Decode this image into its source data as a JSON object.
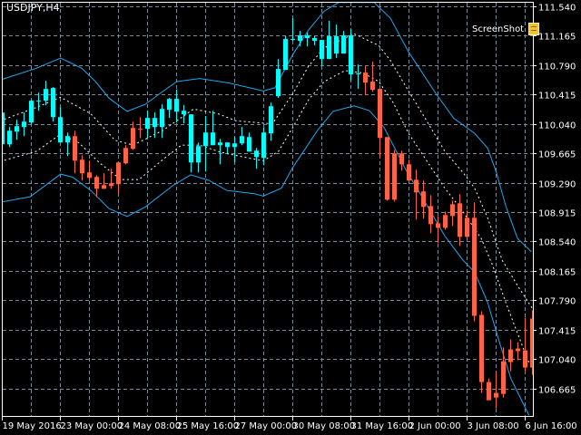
{
  "symbol_label": "USDJPY,H4",
  "screenshot_label": "ScreenShot",
  "colors": {
    "bull": "#00FFFF",
    "bear": "#FF6347",
    "band_outer": "#1EA8F0",
    "band_inner": "#FFFFFF",
    "grid": "#7A8A9A",
    "frame": "#FFFFFF"
  },
  "chart_data": {
    "type": "candlestick",
    "symbol": "USDJPY",
    "timeframe": "H4",
    "ylim": [
      106.32,
      111.59
    ],
    "price_ticks": [
      "111.540",
      "111.165",
      "110.790",
      "110.415",
      "110.040",
      "109.665",
      "109.290",
      "108.915",
      "108.540",
      "108.165",
      "107.790",
      "107.415",
      "107.040",
      "106.665"
    ],
    "time_ticks": [
      "19 May 2016",
      "23 May 00:00",
      "24 May 08:00",
      "25 May 16:00",
      "27 May 00:00",
      "30 May 08:00",
      "31 May 16:00",
      "2 Jun 00:00",
      "3 Jun 08:00",
      "6 Jun 16:00"
    ],
    "candles_ohlc_color": [
      [
        109.78,
        110.231,
        109.745,
        110.185,
        "u"
      ],
      [
        109.953,
        110.0,
        109.745,
        109.78,
        "u"
      ],
      [
        109.942,
        110.092,
        109.838,
        110.011,
        "u"
      ],
      [
        110.0,
        110.185,
        109.884,
        110.069,
        "u"
      ],
      [
        110.058,
        110.347,
        110.035,
        110.336,
        "u"
      ],
      [
        110.336,
        110.44,
        110.208,
        110.33,
        "u"
      ],
      [
        110.336,
        110.59,
        110.278,
        110.486,
        "u"
      ],
      [
        110.498,
        110.509,
        110.069,
        110.127,
        "u"
      ],
      [
        110.127,
        110.255,
        109.803,
        109.803,
        "u"
      ],
      [
        109.803,
        109.93,
        109.629,
        109.884,
        "u"
      ],
      [
        109.884,
        109.953,
        109.409,
        109.571,
        "d"
      ],
      [
        109.583,
        109.64,
        109.317,
        109.409,
        "d"
      ],
      [
        109.421,
        109.571,
        109.317,
        109.351,
        "d"
      ],
      [
        109.363,
        109.386,
        109.108,
        109.212,
        "d"
      ],
      [
        109.212,
        109.409,
        109.212,
        109.259,
        "d"
      ],
      [
        109.247,
        109.467,
        109.212,
        109.282,
        "d"
      ],
      [
        109.27,
        109.548,
        109.143,
        109.548,
        "d"
      ],
      [
        109.537,
        109.768,
        109.525,
        109.733,
        "d"
      ],
      [
        109.722,
        110.069,
        109.71,
        109.988,
        "d"
      ],
      [
        109.977,
        110.127,
        109.861,
        109.97,
        "d"
      ],
      [
        109.977,
        110.208,
        109.861,
        110.116,
        "u"
      ],
      [
        110.116,
        110.185,
        109.861,
        110.0,
        "u"
      ],
      [
        110.0,
        110.289,
        109.861,
        110.231,
        "u"
      ],
      [
        110.22,
        110.37,
        110.116,
        110.359,
        "u"
      ],
      [
        110.359,
        110.475,
        110.058,
        110.197,
        "u"
      ],
      [
        110.208,
        110.278,
        110.046,
        110.162,
        "u"
      ],
      [
        110.162,
        110.162,
        109.421,
        109.548,
        "u"
      ],
      [
        109.548,
        109.803,
        109.421,
        109.757,
        "u"
      ],
      [
        109.757,
        110.139,
        109.432,
        109.93,
        "u"
      ],
      [
        109.93,
        110.208,
        109.768,
        109.768,
        "u"
      ],
      [
        109.768,
        109.849,
        109.525,
        109.803,
        "u"
      ],
      [
        109.803,
        109.803,
        109.652,
        109.745,
        "u"
      ],
      [
        109.745,
        109.872,
        109.548,
        109.791,
        "u"
      ],
      [
        109.791,
        110.0,
        109.768,
        109.884,
        "u"
      ],
      [
        109.872,
        109.93,
        109.687,
        109.687,
        "u"
      ],
      [
        109.699,
        109.733,
        109.467,
        109.618,
        "u"
      ],
      [
        109.606,
        110.0,
        109.513,
        109.93,
        "u"
      ],
      [
        109.919,
        110.312,
        109.826,
        110.266,
        "u"
      ],
      [
        110.394,
        110.868,
        110.37,
        110.741,
        "u"
      ],
      [
        110.729,
        111.158,
        110.729,
        111.123,
        "u"
      ],
      [
        111.123,
        111.389,
        111.1,
        111.12,
        "u"
      ],
      [
        111.1,
        111.227,
        111.03,
        111.169,
        "u"
      ],
      [
        111.169,
        111.204,
        111.03,
        111.135,
        "u"
      ],
      [
        111.135,
        111.158,
        111.042,
        111.1,
        "u"
      ],
      [
        111.111,
        111.111,
        110.787,
        110.868,
        "u"
      ],
      [
        110.868,
        111.355,
        110.868,
        111.158,
        "u"
      ],
      [
        111.158,
        111.308,
        110.88,
        110.938,
        "u"
      ],
      [
        110.938,
        111.227,
        110.938,
        111.169,
        "u"
      ],
      [
        111.169,
        111.25,
        110.59,
        110.671,
        "u"
      ],
      [
        110.683,
        110.799,
        110.486,
        110.68,
        "u"
      ],
      [
        110.695,
        110.776,
        110.405,
        110.567,
        "d"
      ],
      [
        110.579,
        110.834,
        110.451,
        110.475,
        "d"
      ],
      [
        110.486,
        110.486,
        109.618,
        109.861,
        "d"
      ],
      [
        109.872,
        109.872,
        109.062,
        109.073,
        "d"
      ],
      [
        109.664,
        109.71,
        109.05,
        109.073,
        "d"
      ],
      [
        109.664,
        109.699,
        109.444,
        109.525,
        "d"
      ],
      [
        109.525,
        109.583,
        109.317,
        109.317,
        "d"
      ],
      [
        109.328,
        109.456,
        108.819,
        109.166,
        "d"
      ],
      [
        109.178,
        109.317,
        108.83,
        108.981,
        "d"
      ],
      [
        108.992,
        109.131,
        108.645,
        108.761,
        "d"
      ],
      [
        108.772,
        108.865,
        108.518,
        108.714,
        "d"
      ],
      [
        108.714,
        108.923,
        108.691,
        108.877,
        "d"
      ],
      [
        108.865,
        109.062,
        108.738,
        109.015,
        "d"
      ],
      [
        109.027,
        109.143,
        108.483,
        108.599,
        "d"
      ],
      [
        108.842,
        108.934,
        108.587,
        108.599,
        "d"
      ],
      [
        108.842,
        109.039,
        107.522,
        107.591,
        "d"
      ],
      [
        107.603,
        107.649,
        106.607,
        106.746,
        "d"
      ],
      [
        106.746,
        106.792,
        106.514,
        106.514,
        "d"
      ],
      [
        106.607,
        106.873,
        106.41,
        106.549,
        "d"
      ],
      [
        106.595,
        107.186,
        106.549,
        107.012,
        "d"
      ],
      [
        107.001,
        107.29,
        106.885,
        107.163,
        "d"
      ],
      [
        107.174,
        107.255,
        107.024,
        107.14,
        "d"
      ],
      [
        107.151,
        107.568,
        106.873,
        106.931,
        "d"
      ],
      [
        106.931,
        107.661,
        106.838,
        107.556,
        "d"
      ]
    ],
    "bands_bar_index_price": {
      "outer_upper": [
        [
          -0.25,
          110.6
        ],
        [
          4.75,
          110.75
        ],
        [
          8.1,
          110.88
        ],
        [
          11,
          110.75
        ],
        [
          12.9,
          110.58
        ],
        [
          14.75,
          110.37
        ],
        [
          17.25,
          110.2
        ],
        [
          19.75,
          110.29
        ],
        [
          22.25,
          110.46
        ],
        [
          24.1,
          110.58
        ],
        [
          27.25,
          110.62
        ],
        [
          31.4,
          110.56
        ],
        [
          36,
          110.46
        ],
        [
          37.6,
          110.5
        ],
        [
          40.1,
          110.93
        ],
        [
          42.25,
          111.24
        ],
        [
          44.4,
          111.48
        ],
        [
          46.4,
          111.59
        ],
        [
          51.25,
          111.59
        ],
        [
          53.5,
          111.39
        ],
        [
          56,
          110.96
        ],
        [
          59.75,
          110.43
        ],
        [
          62.25,
          110.11
        ],
        [
          65.1,
          109.92
        ],
        [
          66.9,
          109.73
        ],
        [
          68.1,
          109.42
        ],
        [
          69.4,
          108.99
        ],
        [
          71,
          108.58
        ],
        [
          72.9,
          108.41
        ]
      ],
      "inner_upper": [
        [
          -0.25,
          110.08
        ],
        [
          4.75,
          110.25
        ],
        [
          8.1,
          110.38
        ],
        [
          12.25,
          110.17
        ],
        [
          15.6,
          109.83
        ],
        [
          18.1,
          109.77
        ],
        [
          22.25,
          109.96
        ],
        [
          26.4,
          110.23
        ],
        [
          29.75,
          110.17
        ],
        [
          32.25,
          110.08
        ],
        [
          37.25,
          110.04
        ],
        [
          40.1,
          110.43
        ],
        [
          42.25,
          110.78
        ],
        [
          44.4,
          111.01
        ],
        [
          48.5,
          111.19
        ],
        [
          51.9,
          111.04
        ],
        [
          53.5,
          110.85
        ],
        [
          56,
          110.46
        ],
        [
          58.5,
          110.08
        ],
        [
          61,
          109.69
        ],
        [
          63.5,
          109.42
        ],
        [
          65.1,
          109.22
        ],
        [
          66.9,
          108.84
        ],
        [
          68.9,
          108.3
        ],
        [
          71.4,
          107.92
        ],
        [
          73.1,
          107.68
        ]
      ],
      "inner_lower": [
        [
          -0.25,
          109.56
        ],
        [
          4.75,
          109.69
        ],
        [
          8.1,
          109.91
        ],
        [
          10.6,
          109.8
        ],
        [
          13.5,
          109.54
        ],
        [
          16.4,
          109.33
        ],
        [
          18.9,
          109.33
        ],
        [
          22.25,
          109.59
        ],
        [
          24.75,
          109.77
        ],
        [
          27.25,
          109.77
        ],
        [
          30.1,
          109.68
        ],
        [
          33.1,
          109.62
        ],
        [
          36,
          109.57
        ],
        [
          38.1,
          109.69
        ],
        [
          40.1,
          110.0
        ],
        [
          42.25,
          110.35
        ],
        [
          44.4,
          110.58
        ],
        [
          47.25,
          110.72
        ],
        [
          49.75,
          110.69
        ],
        [
          51.9,
          110.58
        ],
        [
          53.9,
          110.31
        ],
        [
          56,
          109.92
        ],
        [
          58.5,
          109.57
        ],
        [
          61,
          109.22
        ],
        [
          63.5,
          108.92
        ],
        [
          66,
          108.58
        ],
        [
          67.6,
          108.23
        ],
        [
          69.4,
          107.76
        ],
        [
          71,
          107.37
        ],
        [
          72.6,
          106.99
        ]
      ],
      "outer_lower": [
        [
          -0.25,
          109.04
        ],
        [
          3.9,
          109.11
        ],
        [
          8.1,
          109.4
        ],
        [
          9.75,
          109.36
        ],
        [
          12.25,
          109.19
        ],
        [
          14.75,
          108.96
        ],
        [
          17.25,
          108.86
        ],
        [
          19.75,
          108.98
        ],
        [
          23.5,
          109.25
        ],
        [
          26,
          109.39
        ],
        [
          28.5,
          109.32
        ],
        [
          31,
          109.19
        ],
        [
          34.75,
          109.15
        ],
        [
          36,
          109.12
        ],
        [
          38.5,
          109.22
        ],
        [
          40.1,
          109.49
        ],
        [
          43.5,
          109.96
        ],
        [
          45.6,
          110.2
        ],
        [
          48.5,
          110.27
        ],
        [
          50.6,
          110.21
        ],
        [
          52.6,
          110.0
        ],
        [
          55.6,
          109.46
        ],
        [
          57.6,
          109.15
        ],
        [
          61,
          108.61
        ],
        [
          63.5,
          108.3
        ],
        [
          65.1,
          108.15
        ],
        [
          66.9,
          107.76
        ],
        [
          68.5,
          107.26
        ],
        [
          70.1,
          106.79
        ],
        [
          72.6,
          106.32
        ]
      ]
    }
  }
}
